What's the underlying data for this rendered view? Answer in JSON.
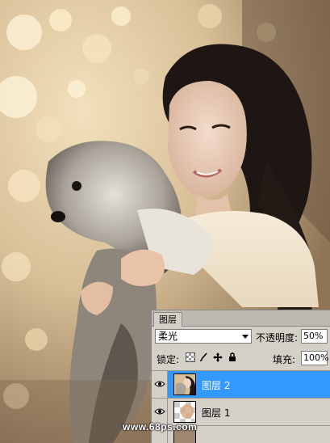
{
  "layers_panel": {
    "tab_label": "图层",
    "blend_mode": "柔光",
    "opacity_label": "不透明度:",
    "opacity_value": "50%",
    "lock_label": "锁定:",
    "fill_label": "填充:",
    "fill_value": "100%",
    "lock_icons": [
      "lock-transparent-icon",
      "lock-brush-icon",
      "lock-move-icon",
      "lock-all-icon"
    ],
    "layers": [
      {
        "name": "图层 2",
        "selected": true,
        "visible": true
      },
      {
        "name": "图层 1",
        "selected": false,
        "visible": true
      }
    ],
    "selected_color": "#3399ff"
  },
  "watermark": "www.68ps.com"
}
